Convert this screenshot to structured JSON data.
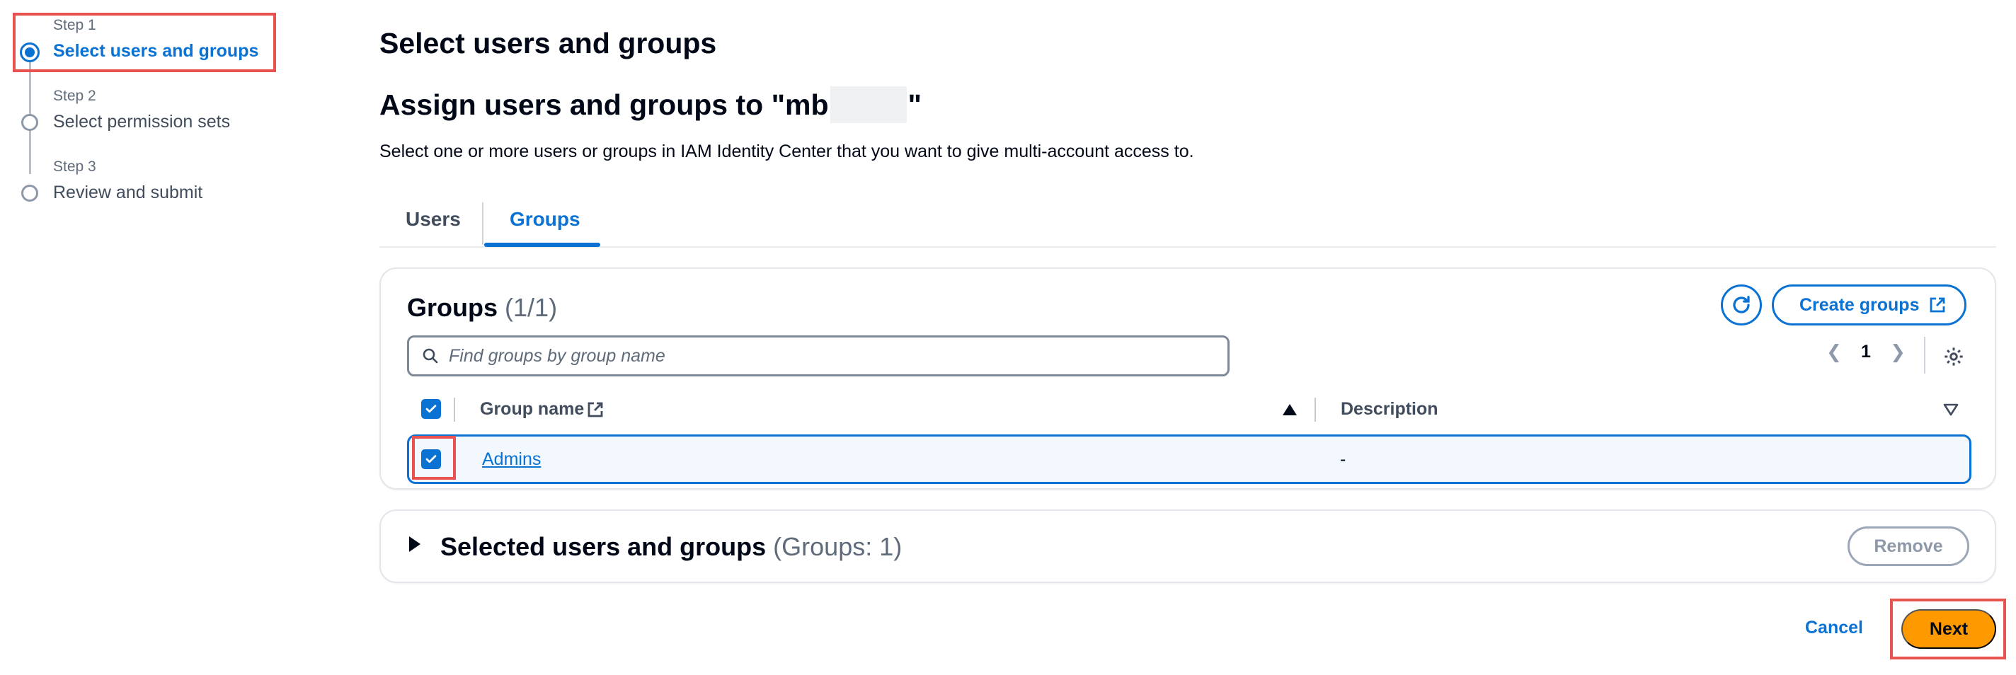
{
  "stepper": {
    "steps": [
      {
        "label": "Step 1",
        "title": "Select users and groups",
        "active": true
      },
      {
        "label": "Step 2",
        "title": "Select permission sets",
        "active": false
      },
      {
        "label": "Step 3",
        "title": "Review and submit",
        "active": false
      }
    ]
  },
  "header": {
    "page_title": "Select users and groups",
    "subtitle_prefix": "Assign users and groups to \"mb",
    "subtitle_suffix": "\"",
    "description": "Select one or more users or groups in IAM Identity Center that you want to give multi-account access to."
  },
  "tabs": [
    {
      "label": "Users",
      "active": false
    },
    {
      "label": "Groups",
      "active": true
    }
  ],
  "groups_table": {
    "title": "Groups",
    "count": "(1/1)",
    "refresh_icon": "refresh-icon",
    "create_label": "Create groups",
    "create_icon": "external-link-icon",
    "search_placeholder": "Find groups by group name",
    "search_value": "",
    "page_number": "1",
    "settings_icon": "gear-icon",
    "columns": [
      {
        "label": "Group name",
        "sort": "ascending"
      },
      {
        "label": "Description",
        "sort": "none"
      }
    ],
    "rows": [
      {
        "name": "Admins",
        "description": "-",
        "selected": true
      }
    ],
    "select_all_checked": true
  },
  "selected_panel": {
    "title": "Selected users and groups",
    "count": "(Groups: 1)",
    "remove_label": "Remove"
  },
  "footer": {
    "cancel_label": "Cancel",
    "next_label": "Next"
  },
  "colors": {
    "accent": "#0972d3",
    "primary_button": "#ff9900",
    "highlight": "#e8524f"
  }
}
